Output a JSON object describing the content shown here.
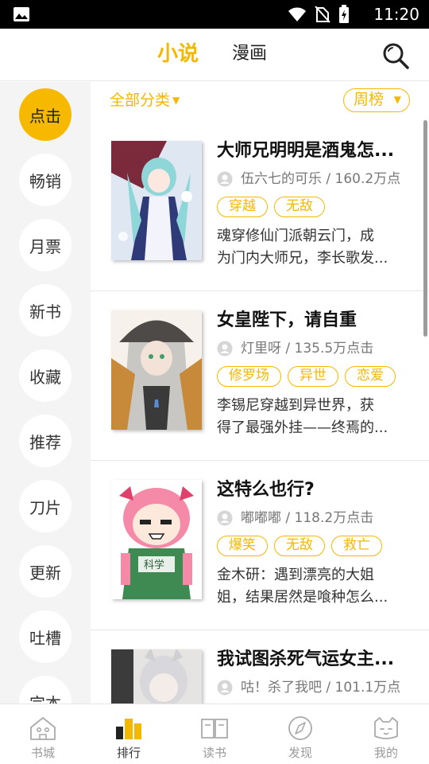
{
  "status": {
    "time": "11:20"
  },
  "header": {
    "tabs": [
      {
        "label": "小说",
        "active": true
      },
      {
        "label": "漫画",
        "active": false
      }
    ]
  },
  "sidebar": {
    "items": [
      {
        "label": "点击",
        "active": true
      },
      {
        "label": "畅销"
      },
      {
        "label": "月票"
      },
      {
        "label": "新书"
      },
      {
        "label": "收藏"
      },
      {
        "label": "推荐"
      },
      {
        "label": "刀片"
      },
      {
        "label": "更新"
      },
      {
        "label": "吐槽"
      },
      {
        "label": "完本"
      }
    ]
  },
  "filters": {
    "category": "全部分类",
    "ranking": "周榜"
  },
  "books": [
    {
      "title": "大师兄明明是酒鬼怎...",
      "author": "伍六七的可乐",
      "stats": "/ 160.2万点",
      "tags": [
        "穿越",
        "无敌"
      ],
      "desc_line1": "魂穿修仙门派朝云门，成",
      "desc_line2": "为门内大师兄，李长歌发..."
    },
    {
      "title": "女皇陛下，请自重",
      "author": "灯里呀",
      "stats": "/ 135.5万点击",
      "tags": [
        "修罗场",
        "异世",
        "恋爱"
      ],
      "desc_line1": "李锡尼穿越到异世界，获",
      "desc_line2": "得了最强外挂——终焉的..."
    },
    {
      "title": "这特么也行?",
      "author": "嘟嘟嘟",
      "stats": "/ 118.2万点击",
      "tags": [
        "爆笑",
        "无敌",
        "救亡"
      ],
      "desc_line1": "金木研：遇到漂亮的大姐",
      "desc_line2": "姐，结果居然是喰种怎么..."
    },
    {
      "title": "我试图杀死气运女主...",
      "author": "咕！杀了我吧",
      "stats": "/ 101.1万点",
      "tags": [
        "",
        ""
      ],
      "desc_line1": "",
      "desc_line2": ""
    }
  ],
  "bottom_nav": {
    "items": [
      {
        "label": "书城",
        "icon": "house-icon"
      },
      {
        "label": "排行",
        "icon": "ranking-icon",
        "active": true
      },
      {
        "label": "读书",
        "icon": "book-icon"
      },
      {
        "label": "发现",
        "icon": "compass-icon"
      },
      {
        "label": "我的",
        "icon": "cat-face-icon"
      }
    ]
  },
  "colors": {
    "accent": "#f5b800",
    "sidebar_bg": "#f4f4f4"
  }
}
